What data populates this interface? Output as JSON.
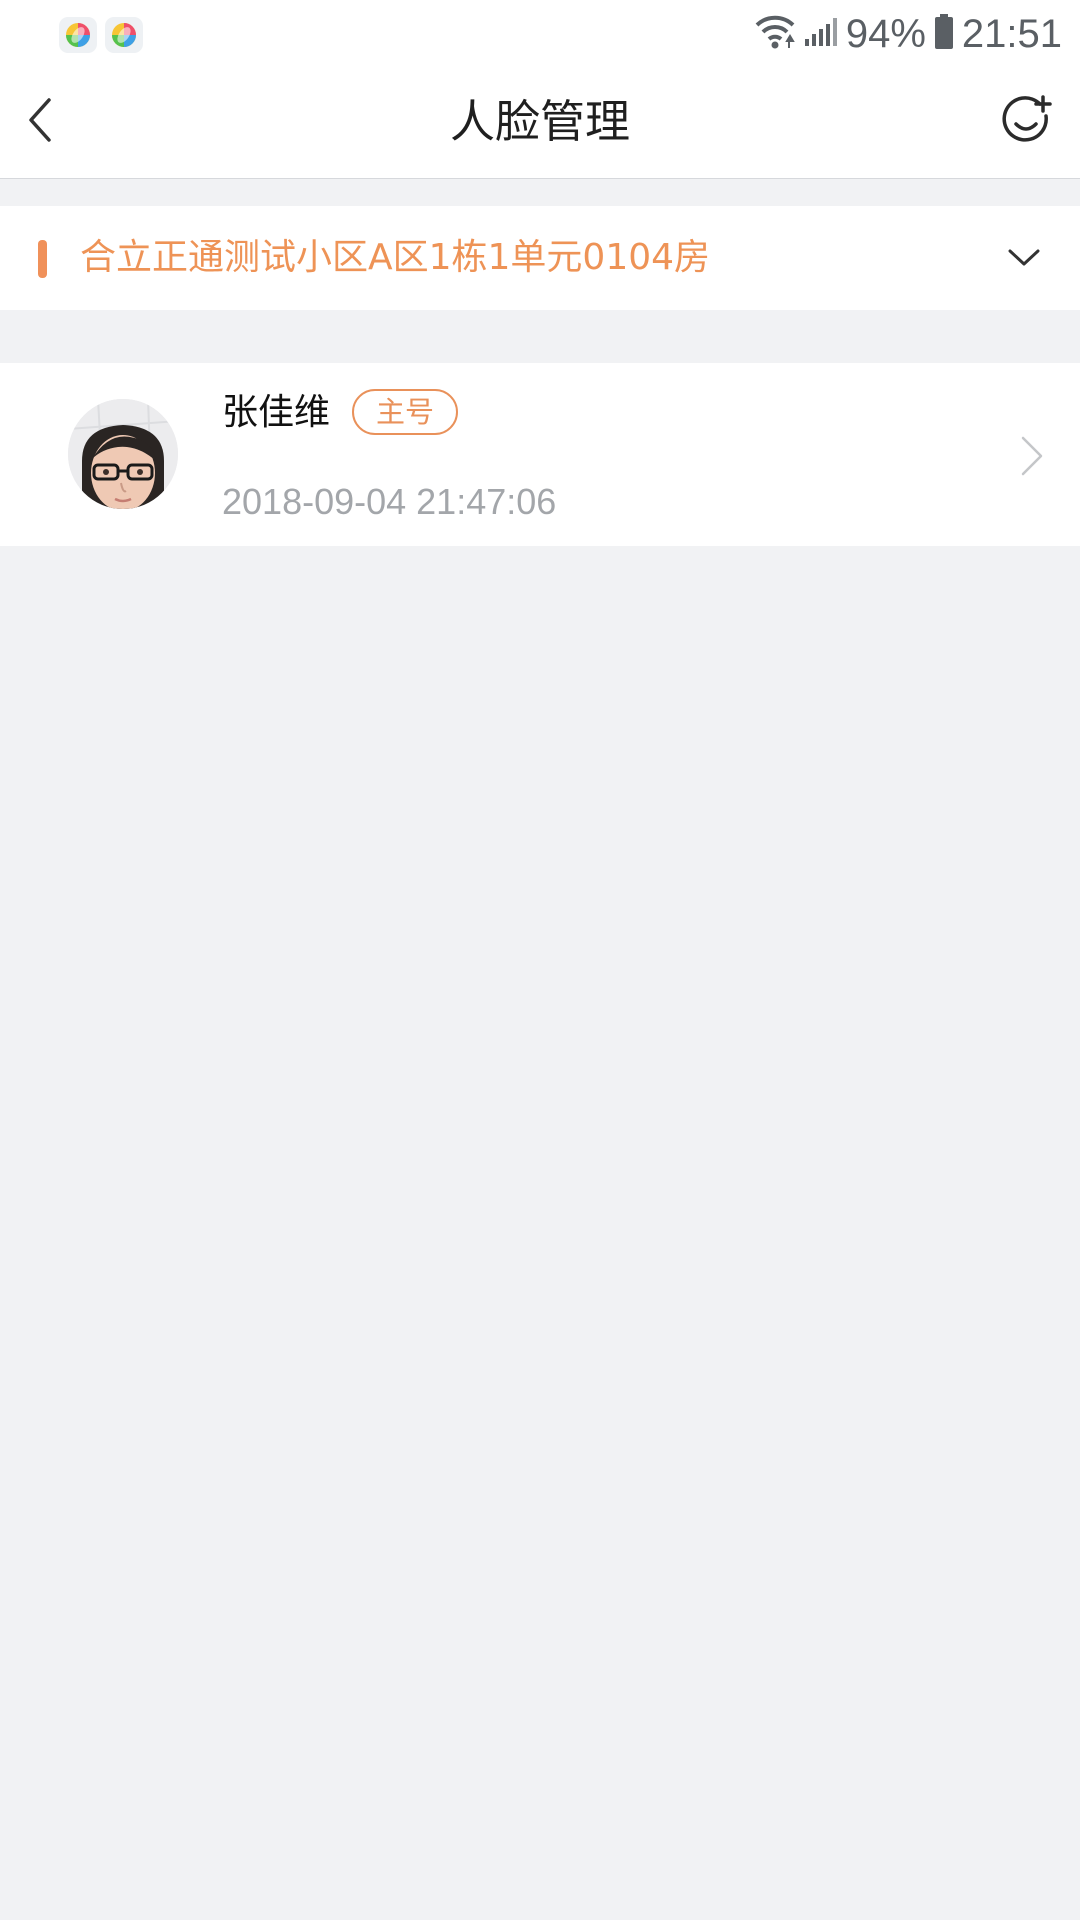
{
  "status_bar": {
    "notification_icons": [
      "app-notification-icon",
      "app-notification-icon"
    ],
    "battery_percent": "94%",
    "time": "21:51"
  },
  "header": {
    "title": "人脸管理",
    "back_icon": "chevron-left-icon",
    "add_icon": "add-face-icon"
  },
  "house": {
    "label": "合立正通测试小区A区1栋1单元0104房",
    "dropdown_icon": "chevron-down-icon"
  },
  "members": [
    {
      "name": "张佳维",
      "badge": "主号",
      "timestamp": "2018-09-04 21:47:06",
      "avatar_icon": "face-photo"
    }
  ],
  "colors": {
    "accent": "#ee9356",
    "background": "#f1f2f4",
    "muted_text": "#a3a6aa"
  }
}
